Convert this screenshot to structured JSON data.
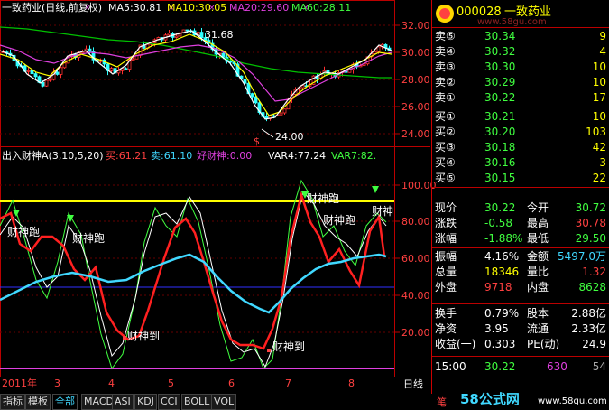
{
  "header": {
    "title": "一致药业(日线,前复权)",
    "ma5": "MA5:30.81",
    "ma10": "MA10:30.05",
    "ma20": "MA20:29.60",
    "ma60": "MA60:28.11"
  },
  "price_axis": [
    "32.00",
    "30.00",
    "28.00",
    "26.00",
    "24.00"
  ],
  "price_annotations": {
    "high": "31.68",
    "low": "24.00"
  },
  "indicator_header": {
    "name": "出入财神A(3,10,5,20)",
    "buy": "买:61.21",
    "sell": "卖:61.10",
    "good": "好财神:0.00",
    "var4": "VAR4:77.24",
    "var7": "VAR7:82."
  },
  "indicator_axis": [
    "100.00",
    "80.00",
    "60.00",
    "40.00",
    "20.00"
  ],
  "signals": {
    "pao1": "财神跑",
    "pao2": "财神跑",
    "pao3": "财神跑",
    "pao4": "财神跑",
    "pao5": "财神",
    "dao1": "财神到",
    "dao2": "财神到"
  },
  "time_axis": {
    "year": "2011年",
    "months": [
      "3",
      "4",
      "5",
      "6",
      "7",
      "8"
    ],
    "period": "日线"
  },
  "stock": {
    "code": "000028",
    "name": "一致药业",
    "watermark": "www.58gu.com"
  },
  "sell_orders": [
    {
      "label": "卖⑤",
      "price": "30.34",
      "vol": "9"
    },
    {
      "label": "卖④",
      "price": "30.32",
      "vol": "4"
    },
    {
      "label": "卖③",
      "price": "30.30",
      "vol": "10"
    },
    {
      "label": "卖②",
      "price": "30.29",
      "vol": "10"
    },
    {
      "label": "卖①",
      "price": "30.22",
      "vol": "17"
    }
  ],
  "buy_orders": [
    {
      "label": "买①",
      "price": "30.21",
      "vol": "10"
    },
    {
      "label": "买②",
      "price": "30.20",
      "vol": "103"
    },
    {
      "label": "买③",
      "price": "30.18",
      "vol": "42"
    },
    {
      "label": "买④",
      "price": "30.16",
      "vol": "3"
    },
    {
      "label": "买⑤",
      "price": "30.15",
      "vol": "22"
    }
  ],
  "quote": {
    "r1": {
      "l1": "现价",
      "v1": "30.22",
      "l2": "今开",
      "v2": "30.72"
    },
    "r2": {
      "l1": "涨跌",
      "v1": "-0.58",
      "l2": "最高",
      "v2": "30.78"
    },
    "r3": {
      "l1": "涨幅",
      "v1": "-1.88%",
      "l2": "最低",
      "v2": "29.50"
    },
    "r4": {
      "l1": "振幅",
      "v1": "4.16%",
      "l2": "金额",
      "v2": "5497.0万"
    },
    "r5": {
      "l1": "总量",
      "v1": "18346",
      "l2": "量比",
      "v2": "1.32"
    },
    "r6": {
      "l1": "外盘",
      "v1": "9718",
      "l2": "内盘",
      "v2": "8628"
    },
    "r7": {
      "l1": "换手",
      "v1": "0.79%",
      "l2": "股本",
      "v2": "2.88亿"
    },
    "r8": {
      "l1": "净资",
      "v1": "3.95",
      "l2": "流通",
      "v2": "2.33亿"
    },
    "r9": {
      "l1": "收益(一)",
      "v1": "0.303",
      "l2": "PE(动)",
      "v2": "24.9"
    }
  },
  "tick": {
    "time": "15:00",
    "price": "30.22",
    "vol": "630",
    "extra": "54"
  },
  "tabs": [
    "指标",
    "模板",
    "全部",
    "MACD",
    "ASI",
    "KDJ",
    "CCI",
    "BOLL",
    "VOL"
  ],
  "footer": {
    "brand": "58公式网",
    "url": "www.58gu.com",
    "side": "笔"
  },
  "colors": {
    "sell": "#ff4040",
    "buy": "#ff4040",
    "down": "#00ff00",
    "label": "#ffffff",
    "yellow": "#ffff00"
  }
}
